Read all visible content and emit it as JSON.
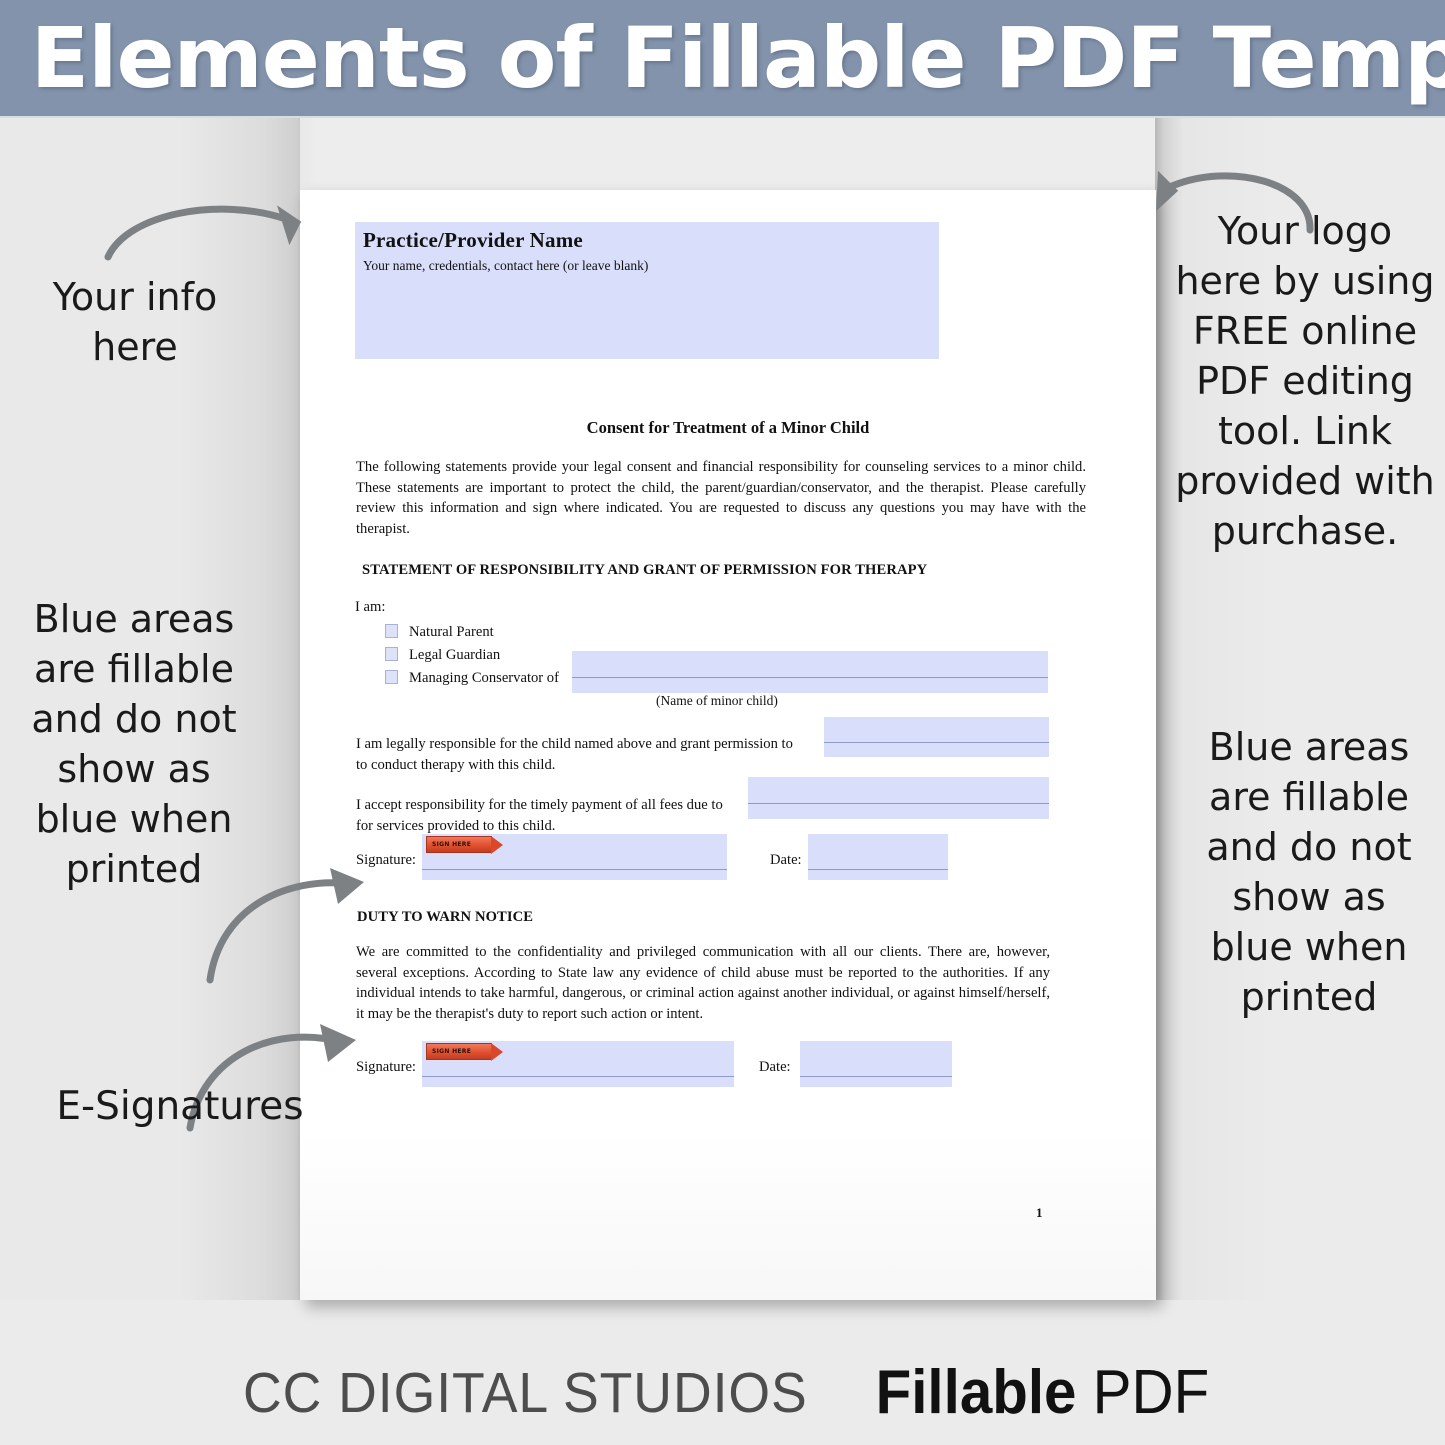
{
  "header": {
    "title": "Elements of Fillable PDF Template",
    "band_color": "#8293ab"
  },
  "annotations": {
    "your_info": "Your info\nhere",
    "blue_areas_left": "Blue areas\nare fillable\nand do not\nshow as\nblue when\nprinted",
    "e_signatures": "E-Signatures",
    "your_logo": "Your logo\nhere by using\nFREE online\nPDF editing\ntool.  Link\nprovided with\npurchase.",
    "blue_areas_right": "Blue areas\nare fillable\nand do not\nshow as\nblue when\nprinted"
  },
  "document": {
    "provider_title": "Practice/Provider Name",
    "provider_subtitle": "Your name, credentials, contact here (or leave blank)",
    "heading": "Consent for Treatment of a Minor Child",
    "intro_paragraph": "The following statements provide your legal consent and financial responsibility for counseling services to a minor child. These statements are important to protect the child, the parent/guardian/conservator, and the therapist. Please carefully review this information and sign where indicated. You are requested to discuss any questions you may have with the therapist.",
    "section_responsibility": "STATEMENT OF RESPONSIBILITY AND GRANT OF PERMISSION FOR THERAPY",
    "i_am_label": "I am:",
    "checkbox_options": [
      "Natural Parent",
      "Legal Guardian",
      "Managing Conservator of"
    ],
    "minor_child_caption": "(Name of minor child)",
    "legal_responsible_paragraph": "I am legally responsible for the child named above and grant permission to                         to conduct therapy with this child.",
    "legal_responsible_line1": "I am legally responsible for the child named above and grant permission to",
    "legal_responsible_line2": "to conduct therapy with this child.",
    "fees_line1": "I accept responsibility for the timely payment of all fees due to",
    "fees_line2": "for services provided to this child.",
    "signature_label": "Signature:",
    "date_label": "Date:",
    "section_duty": "DUTY TO WARN NOTICE",
    "duty_paragraph": "We are committed to the confidentiality and privileged communication with all our clients. There are, however, several exceptions. According to State law any evidence of child abuse must be reported to the authorities. If any individual intends to take harmful, dangerous, or criminal action against another individual, or against himself/herself, it may be the therapist's duty to report such action or intent.",
    "page_number": "1",
    "sign_tag_text": "SIGN HERE",
    "fill_color": "#d9deFA"
  },
  "footer": {
    "brand": "CC DIGITAL STUDIOS",
    "tagline_bold": "Fillable",
    "tagline_rest": " PDF"
  }
}
